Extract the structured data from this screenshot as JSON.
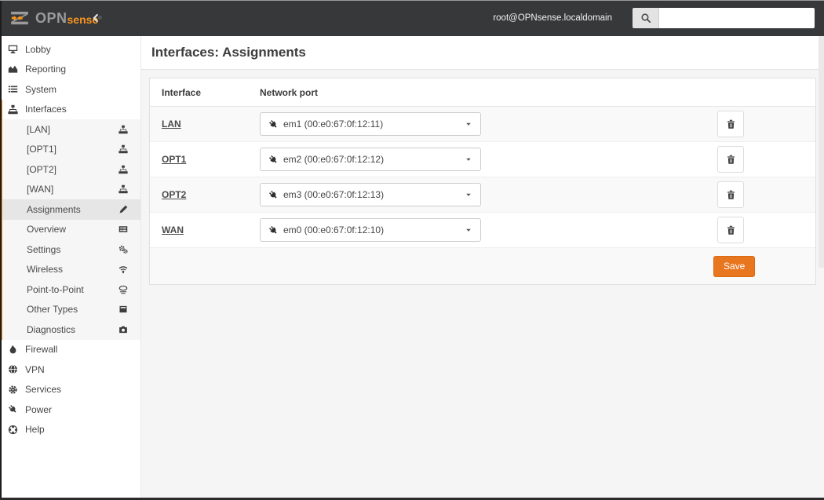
{
  "header": {
    "brand_prefix": "OPN",
    "brand_suffix": "sense",
    "brand_reg": "®",
    "collapse_icon": "chevron-left",
    "user": "root@OPNsense.localdomain",
    "search_icon": "magnifier",
    "search_value": ""
  },
  "sidebar": {
    "top_items": [
      {
        "label": "Lobby",
        "icon": "desktop"
      },
      {
        "label": "Reporting",
        "icon": "area-chart"
      },
      {
        "label": "System",
        "icon": "list-columns"
      }
    ],
    "interfaces": {
      "label": "Interfaces",
      "icon": "sitemap",
      "expanded": true
    },
    "interfaces_submenu": [
      {
        "label": "[LAN]",
        "icon": "sitemap"
      },
      {
        "label": "[OPT1]",
        "icon": "sitemap"
      },
      {
        "label": "[OPT2]",
        "icon": "sitemap"
      },
      {
        "label": "[WAN]",
        "icon": "sitemap"
      },
      {
        "label": "Assignments",
        "icon": "pencil",
        "active": true
      },
      {
        "label": "Overview",
        "icon": "list-alt"
      },
      {
        "label": "Settings",
        "icon": "cogs"
      },
      {
        "label": "Wireless",
        "icon": "wifi"
      },
      {
        "label": "Point-to-Point",
        "icon": "modem"
      },
      {
        "label": "Other Types",
        "icon": "inbox"
      },
      {
        "label": "Diagnostics",
        "icon": "camera"
      }
    ],
    "bottom_items": [
      {
        "label": "Firewall",
        "icon": "fire"
      },
      {
        "label": "VPN",
        "icon": "globe"
      },
      {
        "label": "Services",
        "icon": "gear"
      },
      {
        "label": "Power",
        "icon": "plug"
      },
      {
        "label": "Help",
        "icon": "life-ring"
      }
    ]
  },
  "main": {
    "title": "Interfaces: Assignments",
    "table": {
      "col_interface": "Interface",
      "col_port": "Network port",
      "rows": [
        {
          "interface": "LAN",
          "port": "em1 (00:e0:67:0f:12:11)"
        },
        {
          "interface": "OPT1",
          "port": "em2 (00:e0:67:0f:12:12)"
        },
        {
          "interface": "OPT2",
          "port": "em3 (00:e0:67:0f:12:13)"
        },
        {
          "interface": "WAN",
          "port": "em0 (00:e0:67:0f:12:10)"
        }
      ],
      "delete_icon": "trash",
      "save_label": "Save"
    }
  },
  "colors": {
    "topbar_bg": "#37383a",
    "brand_orange": "#f7941d",
    "accent_orange": "#e8761f",
    "content_bg": "#f5f5f6",
    "active_item_bg": "#e6e6e6"
  }
}
